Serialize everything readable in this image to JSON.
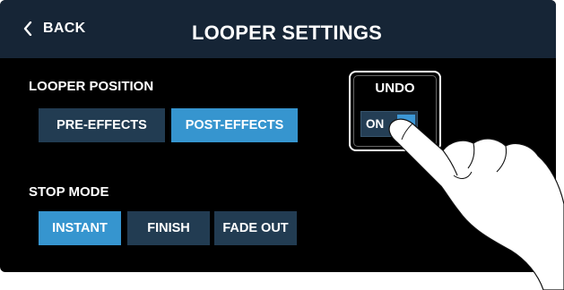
{
  "header": {
    "back_label": "BACK",
    "title": "LOOPER SETTINGS"
  },
  "looper_position": {
    "label": "LOOPER POSITION",
    "options": [
      {
        "label": "PRE-EFFECTS",
        "selected": false
      },
      {
        "label": "POST-EFFECTS",
        "selected": true
      }
    ]
  },
  "stop_mode": {
    "label": "STOP MODE",
    "options": [
      {
        "label": "INSTANT",
        "selected": true
      },
      {
        "label": "FINISH",
        "selected": false
      },
      {
        "label": "FADE OUT",
        "selected": false
      }
    ]
  },
  "undo": {
    "label": "UNDO",
    "toggle_text": "ON",
    "is_on": true
  },
  "colors": {
    "header_bg": "#162536",
    "button_off": "#223c52",
    "button_on": "#3695cf",
    "screen_bg": "#000000"
  }
}
